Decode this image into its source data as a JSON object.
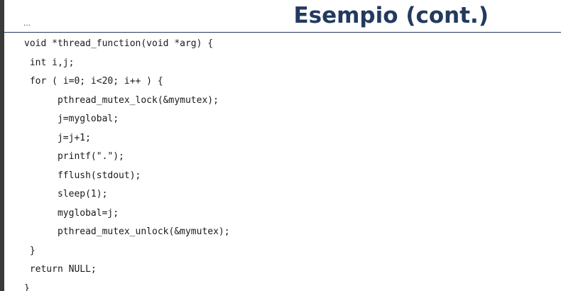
{
  "slide": {
    "ellipsis": "…",
    "title": "Esempio (cont.)"
  },
  "code": {
    "lines": [
      "void *thread_function(void *arg) {",
      " int i,j;",
      " for ( i=0; i<20; i++ ) {",
      "      pthread_mutex_lock(&mymutex);",
      "      j=myglobal;",
      "      j=j+1;",
      "      printf(\".\");",
      "      fflush(stdout);",
      "      sleep(1);",
      "      myglobal=j;",
      "      pthread_mutex_unlock(&mymutex);",
      " }",
      " return NULL;",
      "}"
    ]
  },
  "colors": {
    "title": "#233a5e",
    "left_bar": "#3a3a3a",
    "code_text": "#1a1a1a"
  }
}
